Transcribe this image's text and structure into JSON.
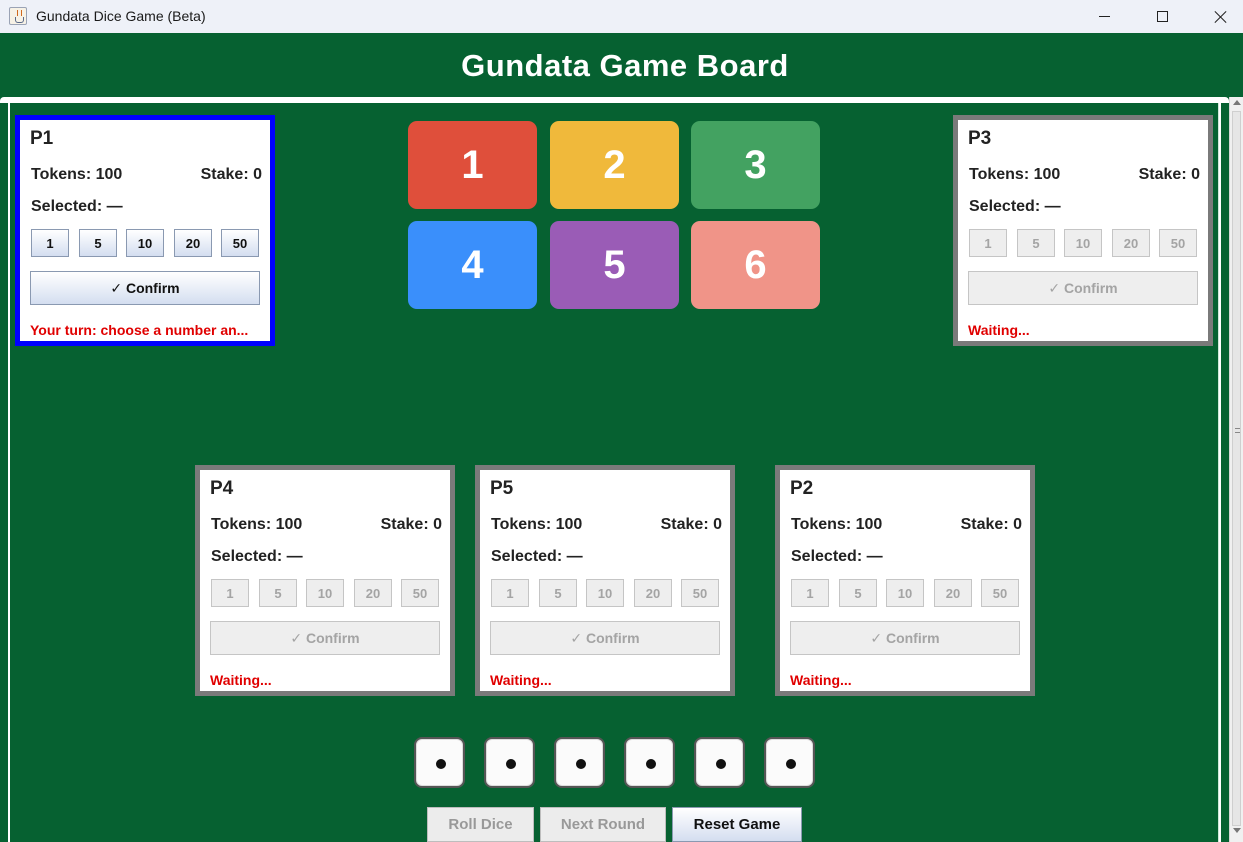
{
  "window": {
    "title": "Gundata Dice Game (Beta)"
  },
  "board": {
    "title": "Gundata Game Board"
  },
  "tiles": [
    {
      "label": "1",
      "color": "#df4f3b"
    },
    {
      "label": "2",
      "color": "#f0b93b"
    },
    {
      "label": "3",
      "color": "#43a261"
    },
    {
      "label": "4",
      "color": "#3a8ffb"
    },
    {
      "label": "5",
      "color": "#9a5cb6"
    },
    {
      "label": "6",
      "color": "#f09488"
    }
  ],
  "players": {
    "p1": {
      "name": "P1",
      "tokens": "Tokens: 100",
      "stake": "Stake: 0",
      "selected": "Selected: —",
      "chips": [
        "1",
        "5",
        "10",
        "20",
        "50"
      ],
      "confirm": "✓ Confirm",
      "status": "Your turn: choose a number an...",
      "active": true
    },
    "p3": {
      "name": "P3",
      "tokens": "Tokens: 100",
      "stake": "Stake: 0",
      "selected": "Selected: —",
      "chips": [
        "1",
        "5",
        "10",
        "20",
        "50"
      ],
      "confirm": "✓ Confirm",
      "status": "Waiting...",
      "active": false
    },
    "p4": {
      "name": "P4",
      "tokens": "Tokens: 100",
      "stake": "Stake: 0",
      "selected": "Selected: —",
      "chips": [
        "1",
        "5",
        "10",
        "20",
        "50"
      ],
      "confirm": "✓ Confirm",
      "status": "Waiting...",
      "active": false
    },
    "p5": {
      "name": "P5",
      "tokens": "Tokens: 100",
      "stake": "Stake: 0",
      "selected": "Selected: —",
      "chips": [
        "1",
        "5",
        "10",
        "20",
        "50"
      ],
      "confirm": "✓ Confirm",
      "status": "Waiting...",
      "active": false
    },
    "p2": {
      "name": "P2",
      "tokens": "Tokens: 100",
      "stake": "Stake: 0",
      "selected": "Selected: —",
      "chips": [
        "1",
        "5",
        "10",
        "20",
        "50"
      ],
      "confirm": "✓ Confirm",
      "status": "Waiting...",
      "active": false
    }
  },
  "dice": {
    "count": 6,
    "face": "single-dot"
  },
  "controls": {
    "roll": "Roll Dice",
    "next": "Next Round",
    "reset": "Reset Game"
  },
  "colors": {
    "table_green": "#066131",
    "active_border": "#0000ff",
    "inactive_border": "#7a7a7a",
    "status_red": "#e00000"
  }
}
